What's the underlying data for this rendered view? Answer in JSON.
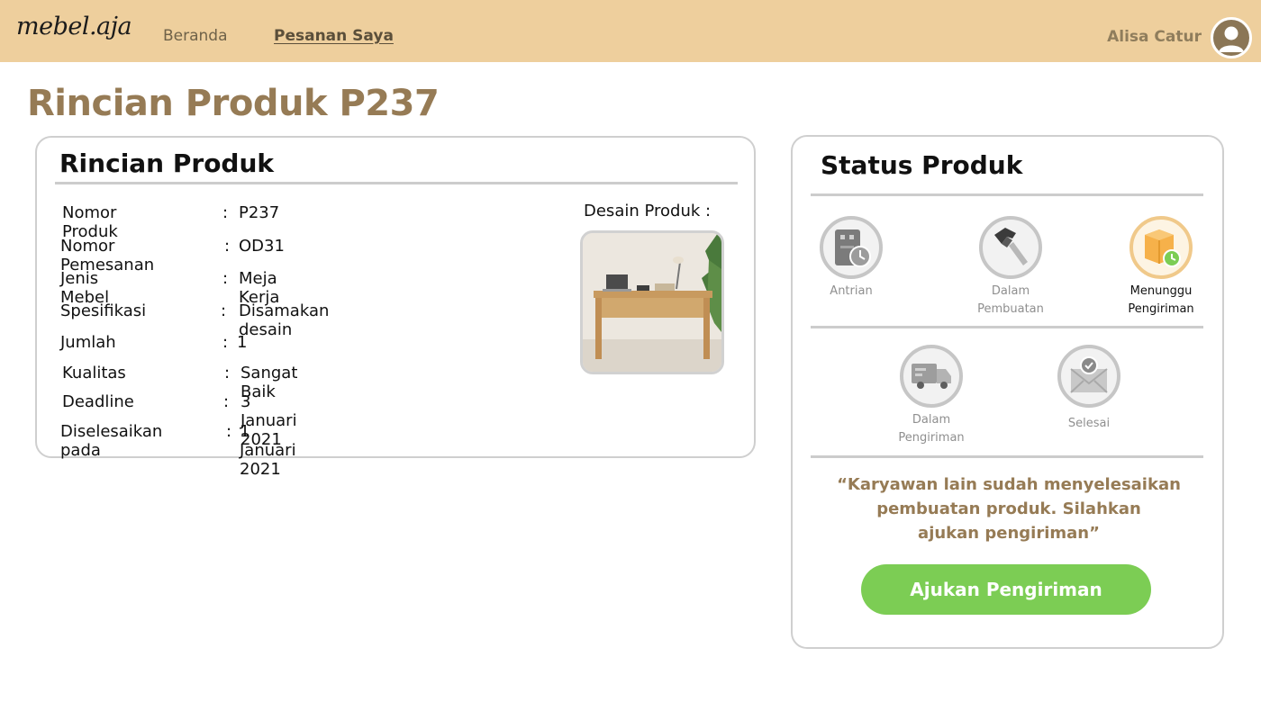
{
  "header": {
    "logo": "mebel.aja",
    "nav": [
      {
        "label": "Beranda"
      },
      {
        "label": "Pesanan Saya"
      }
    ],
    "user_name": "Alisa Catur"
  },
  "page_title": "Rincian Produk P237",
  "detail_card": {
    "title": "Rincian Produk",
    "rows": [
      {
        "label": "Nomor Produk",
        "value": "P237"
      },
      {
        "label": "Nomor Pemesanan",
        "value": "OD31"
      },
      {
        "label": "Jenis Mebel",
        "value": "Meja Kerja"
      },
      {
        "label": "Spesifikasi",
        "value": "Disamakan desain"
      },
      {
        "label": "Jumlah",
        "value": "1"
      },
      {
        "label": "Kualitas",
        "value": "Sangat Baik"
      },
      {
        "label": "Deadline",
        "value": "3 Januari 2021"
      },
      {
        "label": "Diselesaikan pada",
        "value": "1 Januari 2021"
      }
    ],
    "separator": ":",
    "design_label": "Desain Produk  :"
  },
  "status_card": {
    "title": "Status Produk",
    "steps": [
      {
        "label_1": "Antrian",
        "label_2": "",
        "icon": "queue-icon",
        "active": false
      },
      {
        "label_1": "Dalam",
        "label_2": "Pembuatan",
        "icon": "hammer-icon",
        "active": false
      },
      {
        "label_1": "Menunggu",
        "label_2": "Pengiriman",
        "icon": "package-wait-icon",
        "active": true
      },
      {
        "label_1": "Dalam",
        "label_2": "Pengiriman",
        "icon": "truck-icon",
        "active": false
      },
      {
        "label_1": "Selesai",
        "label_2": "",
        "icon": "envelope-check-icon",
        "active": false
      }
    ],
    "message_line_1": "“Karyawan lain sudah menyelesaikan",
    "message_line_2": "pembuatan produk. Silahkan",
    "message_line_3": "ajukan pengiriman”",
    "button_label": "Ajukan Pengiriman"
  },
  "colors": {
    "header_bg": "#eecf9d",
    "title_brown": "#967b55",
    "cta_green": "#7ccd54",
    "active_step_ring": "#f0c98a"
  }
}
